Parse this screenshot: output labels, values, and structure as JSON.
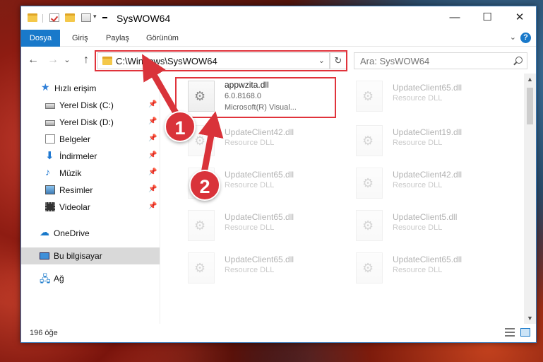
{
  "window": {
    "title": "SysWOW64",
    "minimize": "—",
    "maximize": "☐",
    "close": "✕"
  },
  "ribbon": {
    "tabs": [
      "Dosya",
      "Giriş",
      "Paylaş",
      "Görünüm"
    ],
    "expand": "⌄",
    "help": "?"
  },
  "nav": {
    "back": "←",
    "forward": "→",
    "recent": "⌄",
    "up": "↑",
    "address": "C:\\Windows\\SysWOW64",
    "address_dropdown": "⌄",
    "refresh": "↻",
    "search_placeholder": "Ara: SysWOW64"
  },
  "sidebar": {
    "items": [
      {
        "label": "Hızlı erişim",
        "icon": "star-icon"
      },
      {
        "label": "Yerel Disk (C:)",
        "icon": "drive-icon",
        "pinned": true
      },
      {
        "label": "Yerel Disk (D:)",
        "icon": "drive-icon",
        "pinned": true
      },
      {
        "label": "Belgeler",
        "icon": "documents-icon",
        "pinned": true
      },
      {
        "label": "İndirmeler",
        "icon": "download-icon",
        "pinned": true
      },
      {
        "label": "Müzik",
        "icon": "music-icon",
        "pinned": true
      },
      {
        "label": "Resimler",
        "icon": "pictures-icon",
        "pinned": true
      },
      {
        "label": "Videolar",
        "icon": "videos-icon",
        "pinned": true
      },
      {
        "label": "OneDrive",
        "icon": "cloud-icon"
      },
      {
        "label": "Bu bilgisayar",
        "icon": "computer-icon",
        "selected": true
      },
      {
        "label": "Ağ",
        "icon": "network-icon"
      }
    ]
  },
  "files": [
    {
      "name": "appwzita.dll",
      "line1": "6.0.8168.0",
      "line2": "Microsoft(R) Visual..."
    },
    {
      "name": "UpdateClient65.dll",
      "line1": "Resource DLL"
    },
    {
      "name": "UpdateClient42.dll",
      "line1": "Resource DLL"
    },
    {
      "name": "UpdateClient19.dll",
      "line1": "Resource DLL"
    },
    {
      "name": "UpdateClient65.dll",
      "line1": "Resource DLL"
    },
    {
      "name": "UpdateClient42.dll",
      "line1": "Resource DLL"
    },
    {
      "name": "UpdateClient65.dll",
      "line1": "Resource DLL"
    },
    {
      "name": "UpdateClient5.dll",
      "line1": "Resource DLL"
    },
    {
      "name": "UpdateClient65.dll",
      "line1": "Resource DLL"
    },
    {
      "name": "UpdateClient65.dll",
      "line1": "Resource DLL"
    }
  ],
  "status": {
    "count": "196 öğe"
  },
  "annotations": {
    "step1": "1",
    "step2": "2",
    "highlight_color": "#e0333b"
  },
  "colors": {
    "accent": "#1979ca",
    "selection": "#d9d9d9"
  }
}
